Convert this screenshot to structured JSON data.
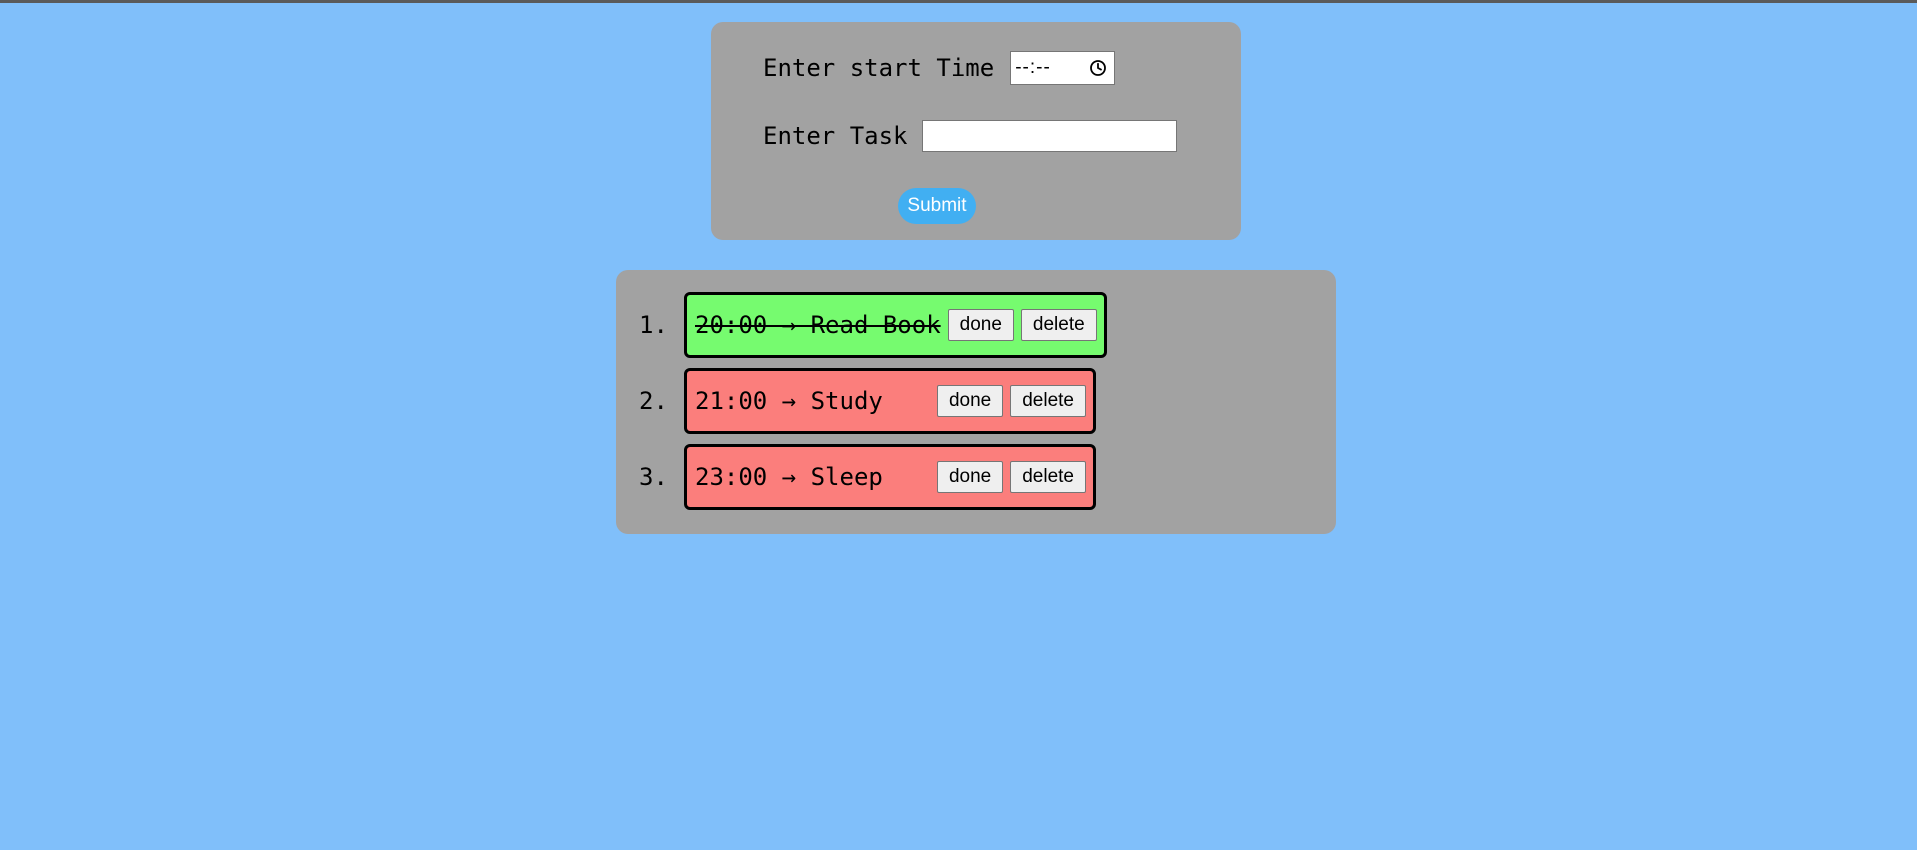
{
  "form": {
    "time_label": "Enter start Time",
    "time_value": "--:--",
    "time_icon": "clock-icon",
    "task_label": "Enter Task",
    "task_value": "",
    "submit_label": "Submit"
  },
  "colors": {
    "page_background": "#80bffa",
    "card_background": "#a2a2a2",
    "done_task": "#76fb6f",
    "pending_task": "#fb7e7c",
    "submit_button": "#41aff2"
  },
  "tasks": [
    {
      "number": "1.",
      "text": "20:00 → Read Book ",
      "status": "done",
      "done_label": "done",
      "delete_label": "delete"
    },
    {
      "number": "2.",
      "text": "21:00 → Study",
      "status": "pending",
      "done_label": "done",
      "delete_label": "delete"
    },
    {
      "number": "3.",
      "text": "23:00 → Sleep",
      "status": "pending",
      "done_label": "done",
      "delete_label": "delete"
    }
  ]
}
